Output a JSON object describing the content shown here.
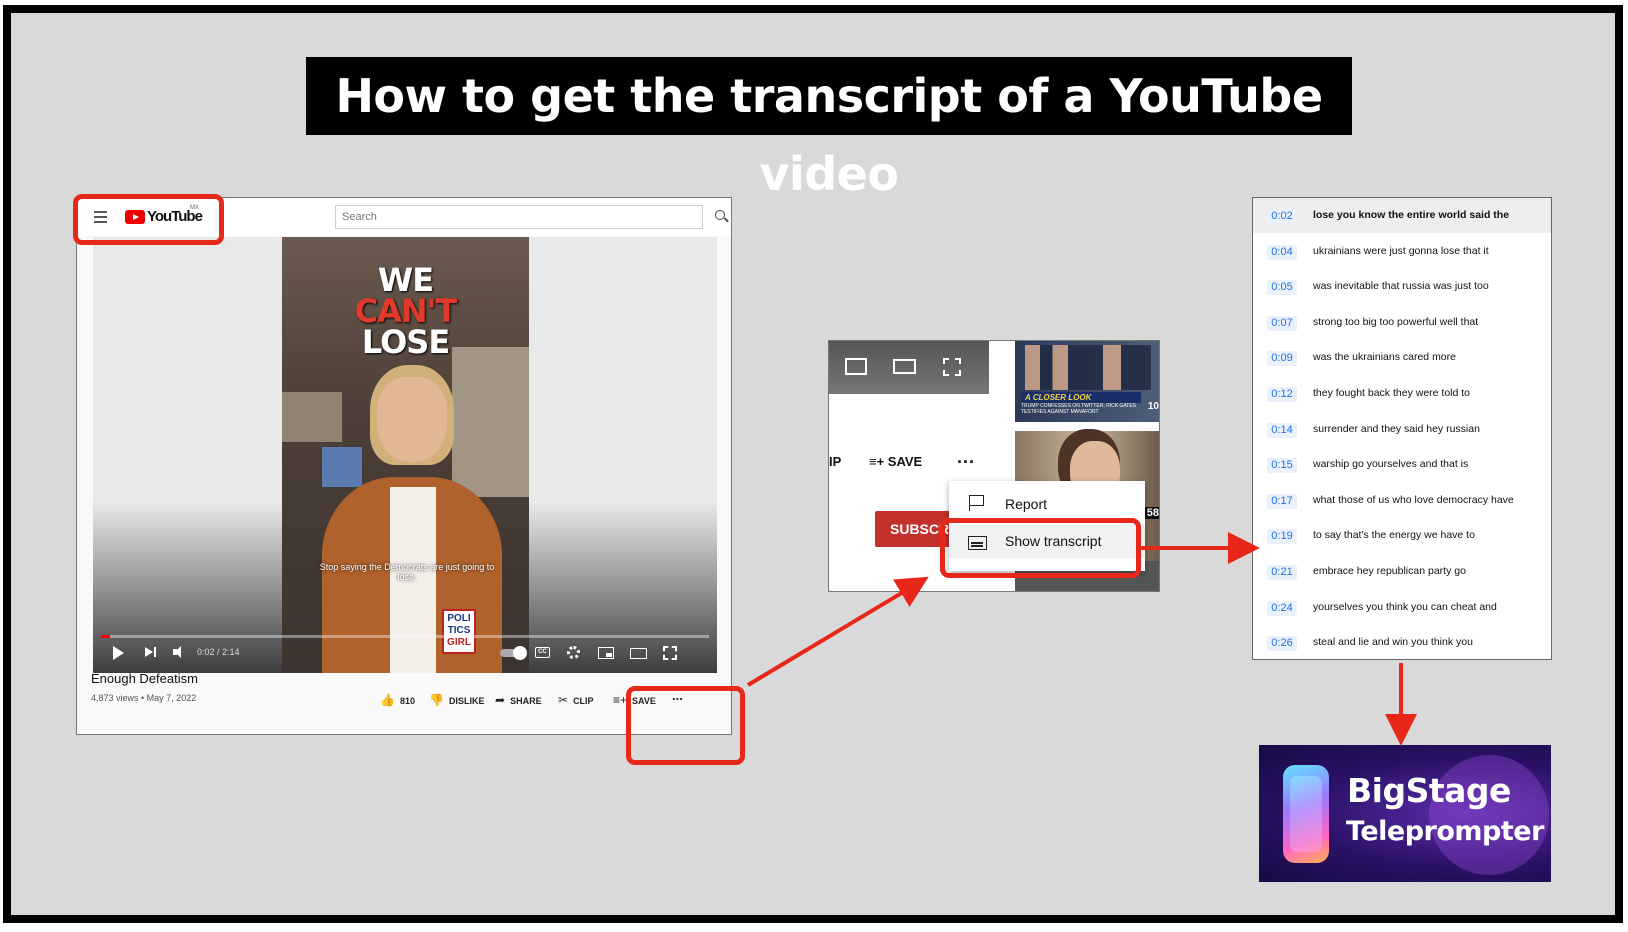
{
  "title": "How to get the transcript of a YouTube video",
  "youtube": {
    "logo_text": "YouTube",
    "logo_region": "MX",
    "search_placeholder": "Search",
    "video_overlay": {
      "headline_line1": "WE",
      "headline_line2": "CAN'T",
      "headline_line3": "LOSE",
      "caption": "Stop saying the Democrats are just going to lose.",
      "badge_line1": "POLI",
      "badge_line2": "TICS",
      "badge_line3": "GIRL"
    },
    "player": {
      "time": "0:02 / 2:14",
      "progress": 0.015,
      "cc_label": "CC"
    },
    "video_title": "Enough Defeatism",
    "meta": "4,873 views • May 7, 2022",
    "actions": {
      "like_count": "810",
      "dislike": "DISLIKE",
      "share": "SHARE",
      "clip": "CLIP",
      "save": "SAVE",
      "more": "..."
    }
  },
  "menu_snippet": {
    "clip_partial": "IP",
    "save": "SAVE",
    "more": "...",
    "subscribe_partial": "SUBSCR",
    "thumbnail1": {
      "banner": "A CLOSER LOOK",
      "subtitle": "TRUMP CONFESSES ON TWITTER; RICK GATES TESTIFIES AGAINST MANAFORT",
      "duration_partial": "10"
    },
    "thumbnail2": {
      "duration_partial": "58"
    },
    "dropdown": {
      "report": "Report",
      "show_transcript": "Show transcript"
    }
  },
  "transcript": [
    {
      "time": "0:02",
      "text": "lose you know the entire world said the"
    },
    {
      "time": "0:04",
      "text": "ukrainians were just gonna lose that it"
    },
    {
      "time": "0:05",
      "text": "was inevitable that russia was just too"
    },
    {
      "time": "0:07",
      "text": "strong too big too powerful well that"
    },
    {
      "time": "0:09",
      "text": "was the ukrainians cared more"
    },
    {
      "time": "0:12",
      "text": "they fought back they were told to"
    },
    {
      "time": "0:14",
      "text": "surrender and they said hey russian"
    },
    {
      "time": "0:15",
      "text": "warship go yourselves and that is"
    },
    {
      "time": "0:17",
      "text": "what those of us who love democracy have"
    },
    {
      "time": "0:19",
      "text": "to say that's the energy we have to"
    },
    {
      "time": "0:21",
      "text": "embrace hey republican party go"
    },
    {
      "time": "0:24",
      "text": "yourselves you think you can cheat and"
    },
    {
      "time": "0:26",
      "text": "steal and lie and win you think you"
    }
  ],
  "bigstage": {
    "line1": "BigStage",
    "line2": "Teleprompter"
  },
  "colors": {
    "highlight": "#e8271b",
    "youtube_red": "#ff0000",
    "timestamp_blue": "#1a73e8"
  }
}
